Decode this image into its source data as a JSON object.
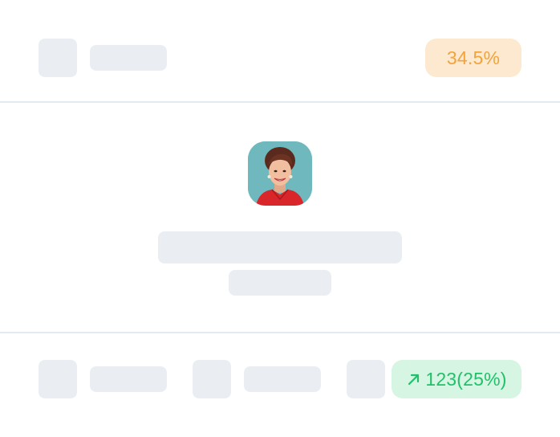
{
  "header": {
    "percent_badge": "34.5%"
  },
  "footer": {
    "growth_badge": "123(25%)",
    "growth_icon": "arrow-up-right-icon"
  },
  "profile": {
    "avatar_icon": "portrait-avatar"
  },
  "colors": {
    "skeleton": "#eaeef3",
    "divider": "#e3ebf2",
    "orange_badge_bg": "#fde9cf",
    "orange_badge_text": "#f2a33c",
    "green_badge_bg": "#d6f5e3",
    "green_badge_text": "#22c06a"
  }
}
